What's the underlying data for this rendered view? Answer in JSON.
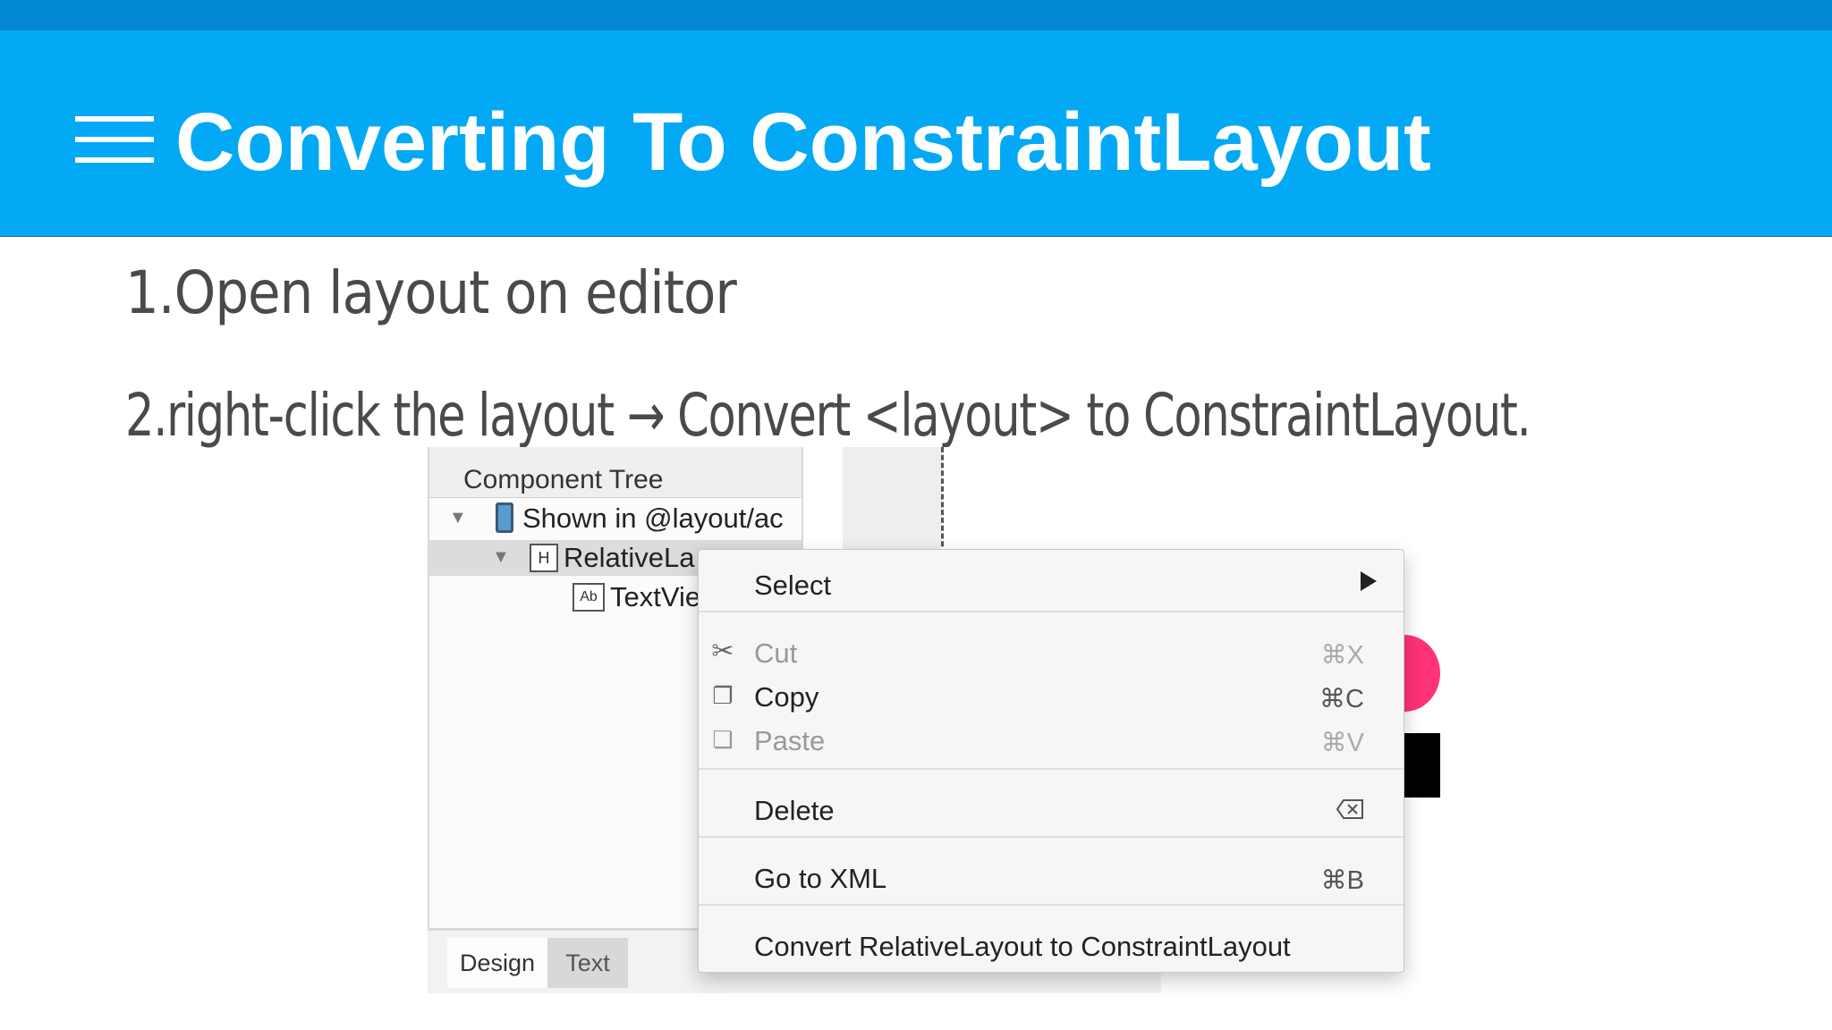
{
  "header": {
    "title": "Converting To ConstraintLayout"
  },
  "steps": [
    "1.Open layout on editor",
    "2.right-click the layout → Convert <layout> to ConstraintLayout."
  ],
  "ide": {
    "tree_title": "Component Tree",
    "tree_items": [
      "Shown in @layout/ac",
      "RelativeLa",
      "TextVie"
    ],
    "bottom_tabs": [
      "Design",
      "Text"
    ],
    "context_menu": {
      "select": "Select",
      "cut": "Cut",
      "cut_shortcut": "⌘X",
      "copy": "Copy",
      "copy_shortcut": "⌘C",
      "paste": "Paste",
      "paste_shortcut": "⌘V",
      "delete": "Delete",
      "goto_xml": "Go to XML",
      "goto_xml_shortcut": "⌘B",
      "convert": "Convert RelativeLayout to ConstraintLayout"
    }
  },
  "icons": [
    "hamburger-menu-icon",
    "phone-icon",
    "relative-layout-icon",
    "textview-icon",
    "scissors-icon",
    "copy-icon",
    "paste-icon",
    "submenu-arrow-icon",
    "delete-key-icon"
  ],
  "colors": {
    "header": "#03a9f4",
    "top_strip": "#0288d1",
    "text": "#4a4a4a"
  }
}
